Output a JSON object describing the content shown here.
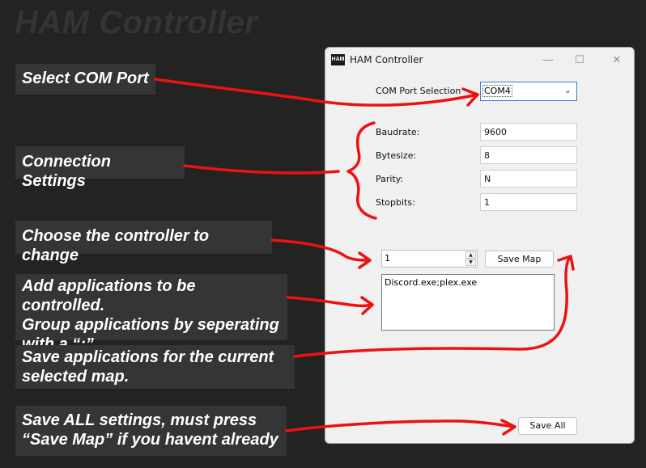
{
  "page_title": "HAM Controller",
  "callouts": {
    "select_com": "Select COM Port",
    "connection": "Connection Settings",
    "choose_controller": "Choose the controller to change",
    "add_apps": "Add applications to be controlled.\nGroup applications by seperating\nwith a “;”",
    "save_apps": "Save applications for the current\nselected map.",
    "save_all": "Save ALL settings, must press\n“Save Map” if you havent already"
  },
  "window": {
    "icon_text": "HAM",
    "title": "HAM Controller",
    "minimize": "—",
    "maximize": "☐",
    "close": "✕",
    "com_label": "COM Port Selection",
    "com_value": "COM4",
    "settings": [
      {
        "label": "Baudrate:",
        "value": "9600"
      },
      {
        "label": "Bytesize:",
        "value": "8"
      },
      {
        "label": "Parity:",
        "value": "N"
      },
      {
        "label": "Stopbits:",
        "value": "1"
      }
    ],
    "controller_value": "1",
    "save_map_label": "Save Map",
    "apps_text": "Discord.exe;plex.exe",
    "save_all_label": "Save All"
  },
  "colors": {
    "annotation": "#ee1111",
    "background": "#232323",
    "callout_bg": "#353535"
  }
}
